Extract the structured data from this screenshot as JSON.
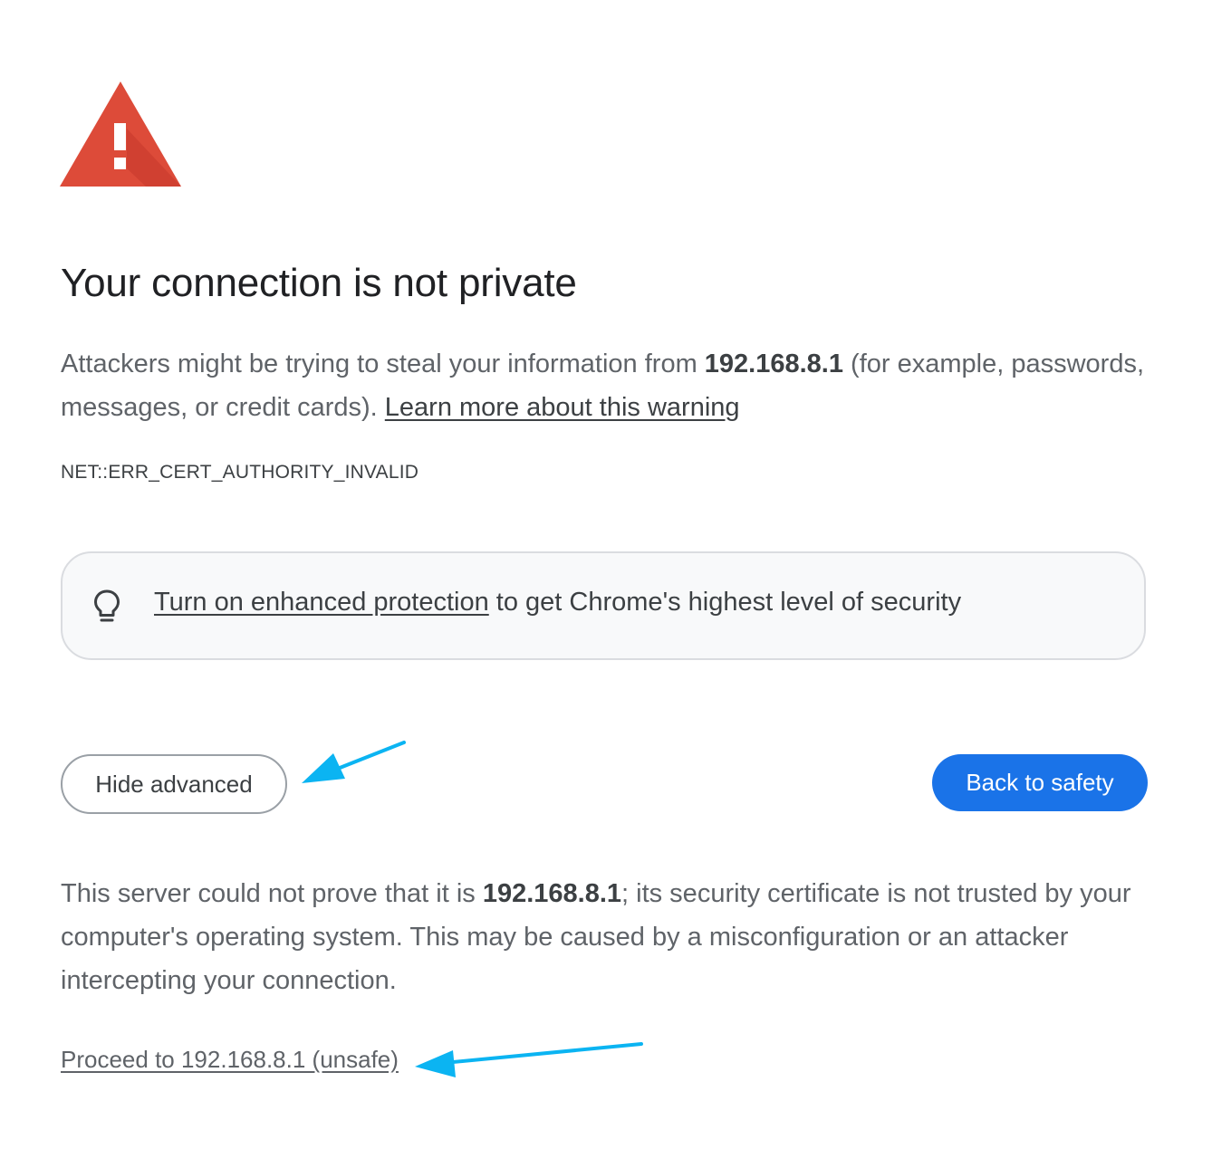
{
  "page": {
    "title": "Your connection is not private",
    "intro": {
      "before_host": "Attackers might be trying to steal your information from ",
      "host": "192.168.8.1",
      "after_host": " (for example, passwords, messages, or credit cards). ",
      "learn_more_link": "Learn more about this warning"
    },
    "error_code": "NET::ERR_CERT_AUTHORITY_INVALID"
  },
  "promo": {
    "icon": "lightbulb-icon",
    "link_text": "Turn on enhanced protection",
    "rest_text": " to get Chrome's highest level of security"
  },
  "buttons": {
    "hide_advanced": "Hide advanced",
    "back_to_safety": "Back to safety"
  },
  "details": {
    "before_host": "This server could not prove that it is ",
    "host": "192.168.8.1",
    "after_host": "; its security certificate is not trusted by your computer's operating system. This may be caused by a misconfiguration or an attacker intercepting your connection."
  },
  "proceed_link": "Proceed to 192.168.8.1 (unsafe)",
  "colors": {
    "warning_red": "#dd4b39",
    "accent_blue": "#1a73e8",
    "annotation_arrow": "#0bb4f2"
  },
  "icons": {
    "warning": "warning-triangle-icon"
  }
}
